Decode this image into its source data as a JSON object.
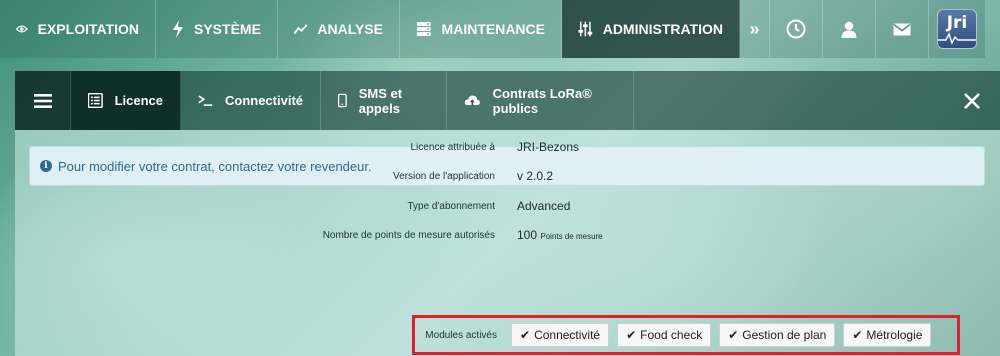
{
  "topnav": {
    "items": [
      {
        "label": "EXPLOITATION",
        "icon": "eye-icon"
      },
      {
        "label": "SYSTÈME",
        "icon": "bolt-icon"
      },
      {
        "label": "ANALYSE",
        "icon": "line-chart-icon"
      },
      {
        "label": "MAINTENANCE",
        "icon": "server-icon"
      },
      {
        "label": "ADMINISTRATION",
        "icon": "sliders-icon",
        "active": true
      }
    ],
    "more": "»",
    "logo_text": "Jri"
  },
  "tabs": [
    {
      "label": "Licence",
      "icon": "list-alt-icon",
      "active": true
    },
    {
      "label": "Connectivité",
      "icon": "terminal-icon"
    },
    {
      "label": "SMS et appels",
      "icon": "mobile-icon"
    },
    {
      "label": "Contrats LoRa® publics",
      "icon": "cloud-upload-icon"
    }
  ],
  "alert": {
    "text": "Pour modifier votre contrat, contactez votre revendeur."
  },
  "details": {
    "licence": {
      "label": "Licence attribuée à",
      "value": "JRI-Bezons"
    },
    "version": {
      "label": "Version de l'application",
      "value": "v 2.0.2"
    },
    "abonnement": {
      "label": "Type d'abonnement",
      "value": "Advanced"
    },
    "points": {
      "label": "Nombre de points de mesure autorisés",
      "value": "100",
      "unit": "Points de mesure"
    }
  },
  "modules": {
    "label": "Modules activés",
    "items": [
      "Connectivité",
      "Food check",
      "Gestion de plan",
      "Métrologie"
    ]
  },
  "colors": {
    "highlight": "#e0202c",
    "alert_text": "#2e6b8f"
  }
}
